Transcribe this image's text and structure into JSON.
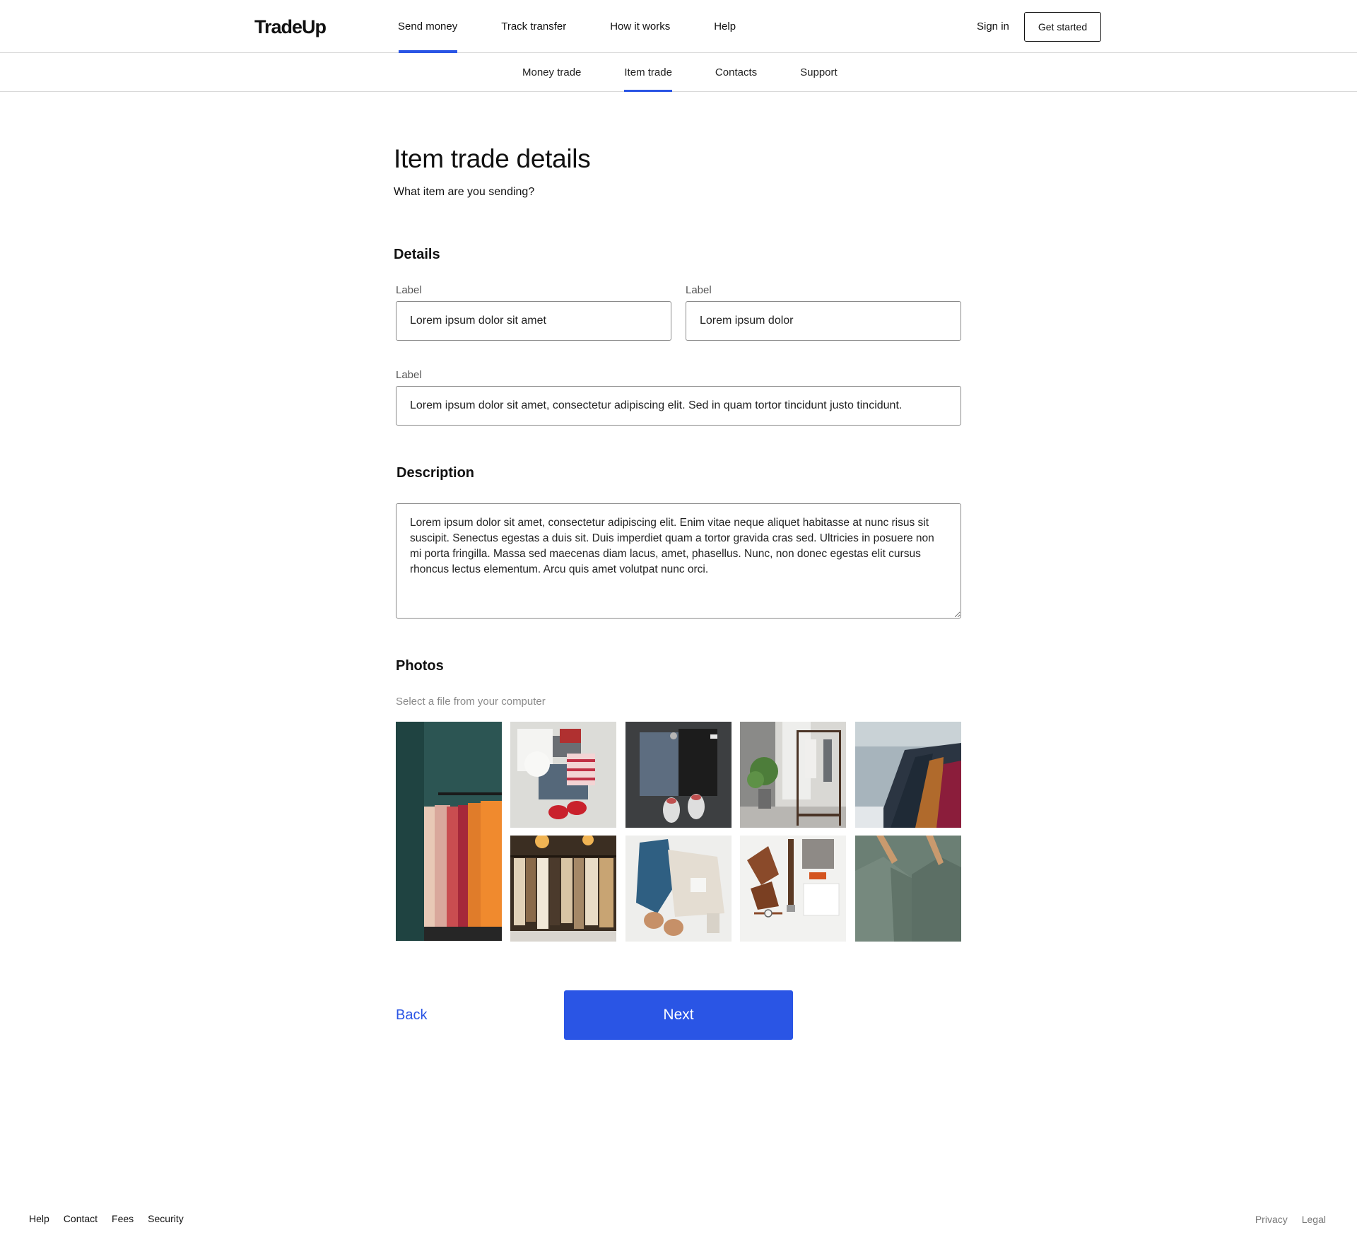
{
  "brand": {
    "name": "TradeUp",
    "accent_color": "#2a55e5"
  },
  "header": {
    "nav": [
      "Send money",
      "Track transfer",
      "How it works",
      "Help"
    ],
    "active_nav": "Send money",
    "sign_in": "Sign in",
    "get_started": "Get started"
  },
  "subnav": {
    "items": [
      "Money trade",
      "Item trade",
      "Contacts",
      "Support"
    ],
    "active": "Item trade"
  },
  "page": {
    "title": "Item trade details",
    "subtitle": "What item are you sending?"
  },
  "details": {
    "heading": "Details",
    "field1": {
      "label": "Label",
      "value": "Lorem ipsum dolor sit amet"
    },
    "field2": {
      "label": "Label",
      "value": "Lorem ipsum dolor"
    },
    "field3": {
      "label": "Label",
      "value": "Lorem ipsum dolor sit amet, consectetur adipiscing elit. Sed in quam tortor tincidunt justo tincidunt."
    }
  },
  "description": {
    "heading": "Description",
    "value": "Lorem ipsum dolor sit amet, consectetur adipiscing elit. Enim vitae neque aliquet habitasse at nunc risus sit suscipit. Senectus egestas a duis sit. Duis imperdiet quam a tortor gravida cras sed. Ultricies in posuere non mi porta fringilla. Massa sed maecenas diam lacus, amet, phasellus. Nunc, non donec egestas elit cursus rhoncus lectus elementum. Arcu quis amet volutpat nunc orci."
  },
  "photos": {
    "heading": "Photos",
    "hint": "Select a file from your computer",
    "items": [
      {
        "name": "clothing-rack-teal-wall",
        "bg": "#2c5553"
      },
      {
        "name": "folded-clothes-red-shoes",
        "bg": "#dcdcd8"
      },
      {
        "name": "jeans-and-sneakers-dark",
        "bg": "#3d3f41"
      },
      {
        "name": "wooden-rack-with-plant",
        "bg": "#d9d8d4"
      },
      {
        "name": "clothes-on-rack-closeup",
        "bg": "#a7b4bc"
      },
      {
        "name": "boutique-clothing-rack",
        "bg": "#3b2e22"
      },
      {
        "name": "jeans-sweater-flatlay",
        "bg": "#eeeeec"
      },
      {
        "name": "boots-belt-flatlay",
        "bg": "#f2f2f0"
      },
      {
        "name": "green-shirts-hangers",
        "bg": "#6b7f74"
      }
    ]
  },
  "actions": {
    "back": "Back",
    "next": "Next"
  },
  "footer": {
    "left_links": [
      "Help",
      "Contact",
      "Fees",
      "Security"
    ],
    "right_links": [
      "Privacy",
      "Legal"
    ]
  }
}
